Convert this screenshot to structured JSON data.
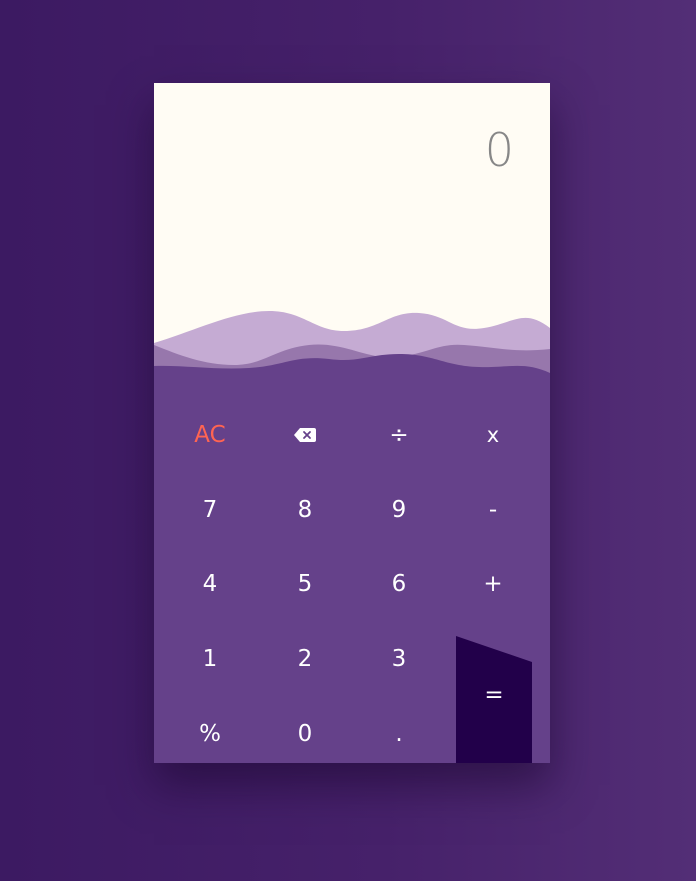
{
  "display": {
    "value": "0"
  },
  "colors": {
    "background_start": "#3c1a62",
    "background_end": "#532e76",
    "display_bg": "#fffcf4",
    "keypad_bg": "#65418a",
    "wave_light": "#c5abd3",
    "wave_mid": "#9777ac",
    "equals_bg": "#22004a",
    "clear_accent": "#ff6452",
    "key_text": "#ffffff"
  },
  "keys": {
    "clear": "AC",
    "backspace_icon": "backspace-icon",
    "divide": "÷",
    "multiply": "x",
    "seven": "7",
    "eight": "8",
    "nine": "9",
    "minus": "-",
    "four": "4",
    "five": "5",
    "six": "6",
    "plus": "+",
    "one": "1",
    "two": "2",
    "three": "3",
    "percent": "%",
    "zero": "0",
    "decimal": ".",
    "equals": "="
  }
}
